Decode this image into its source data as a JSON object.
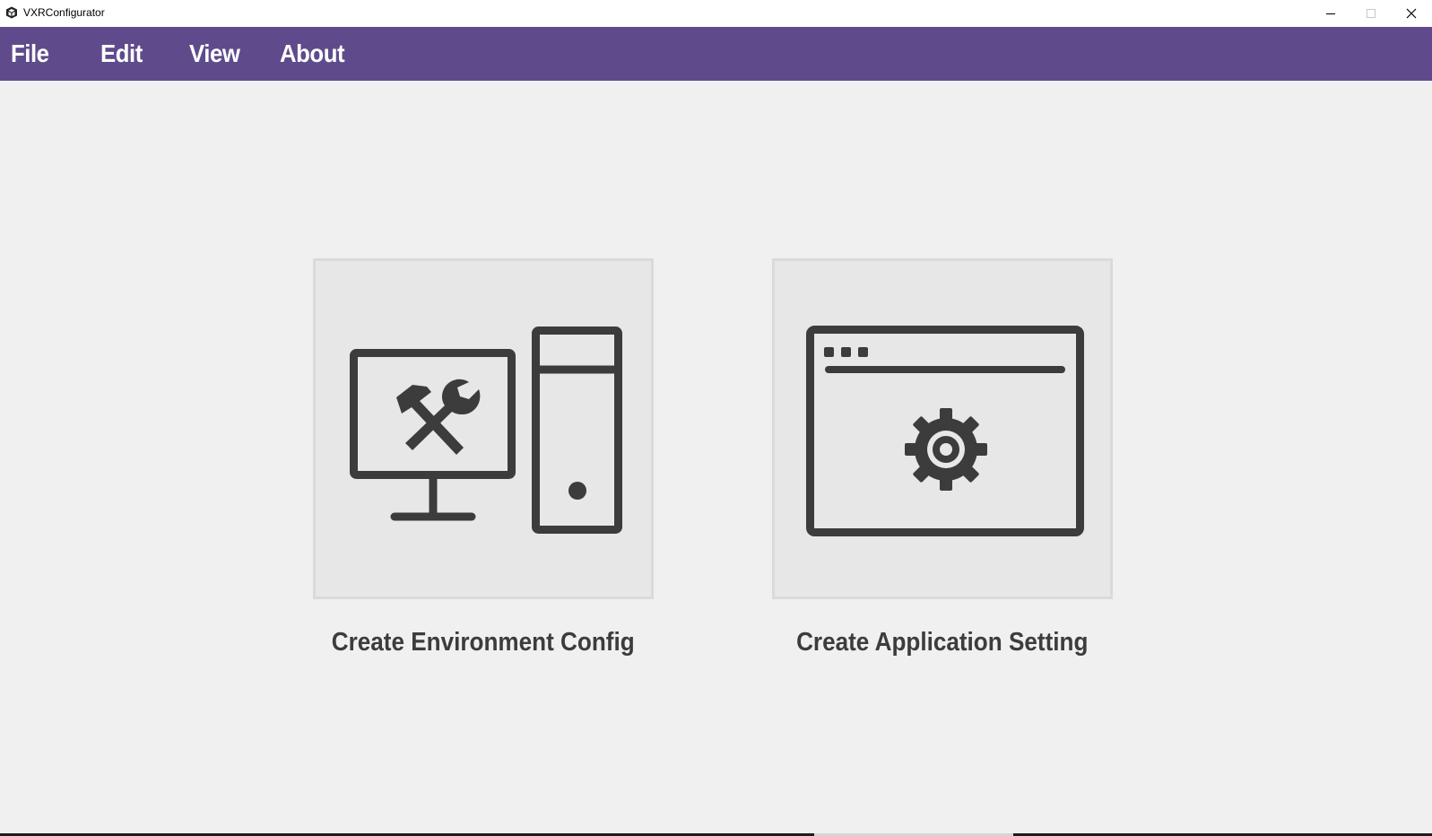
{
  "window": {
    "title": "VXRConfigurator",
    "app_icon": "cube-logo-icon",
    "controls": [
      "minimize-icon",
      "maximize-icon",
      "close-icon"
    ]
  },
  "menu": {
    "items": [
      {
        "label": "File"
      },
      {
        "label": "Edit"
      },
      {
        "label": "View"
      },
      {
        "label": "About"
      }
    ],
    "background": "#5f4b8b"
  },
  "main": {
    "cards": [
      {
        "label": "Create Environment Config",
        "icon": "computer-tools-icon"
      },
      {
        "label": "Create Application Setting",
        "icon": "window-gear-icon"
      }
    ]
  },
  "colors": {
    "accent": "#5f4b8b",
    "icon": "#3c3c3c",
    "card_bg": "#e7e7e7",
    "page_bg": "#f0f0f0"
  }
}
